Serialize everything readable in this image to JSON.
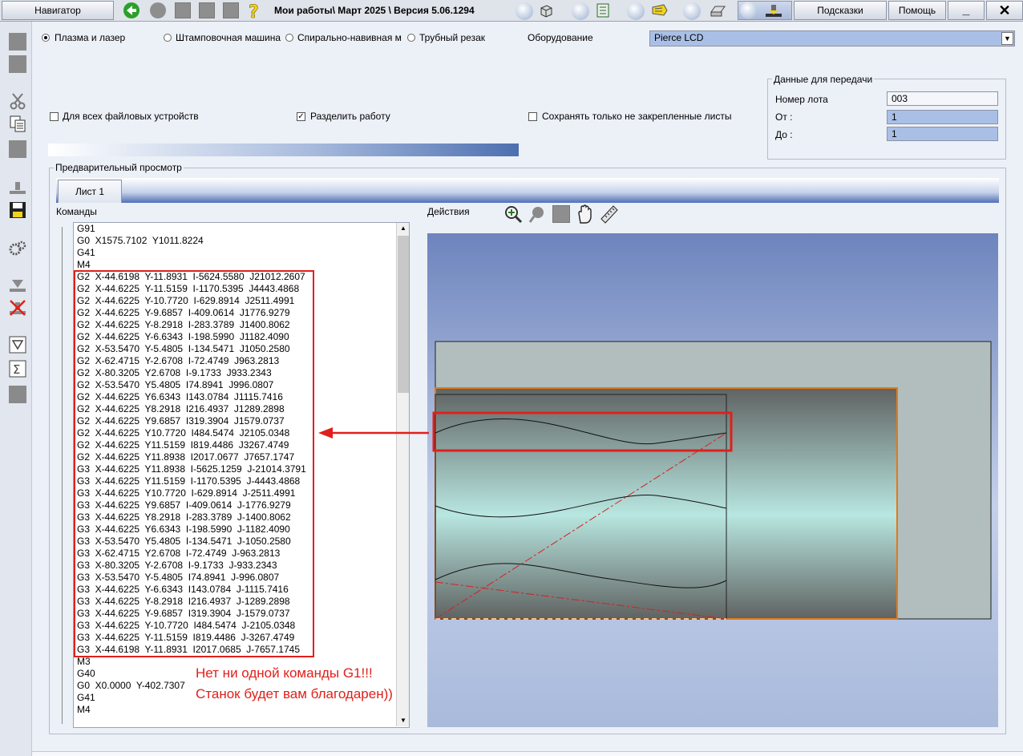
{
  "topbar": {
    "navigator_label": "Навигатор",
    "breadcrumb": "Мои работы\\  Март 2025  \\  Версия 5.06.1294",
    "hints_label": "Подсказки",
    "help_label": "Помощь",
    "minimize_label": "_",
    "close_label": "✕"
  },
  "machines": {
    "plasma_label": "Плазма и лазер",
    "stamping_label": "Штамповочная машина",
    "spiral_label": "Спирально-навивная м",
    "pipe_label": "Трубный резак",
    "selected": "Плазма и лазер"
  },
  "equipment": {
    "label": "Оборудование",
    "value": "Pierce LCD"
  },
  "options": {
    "all_devices_label": "Для всех файловых устройств",
    "split_work_label": "Разделить работу",
    "save_unlocked_label": "Сохранять только не закрепленные листы"
  },
  "transfer": {
    "title": "Данные для передачи",
    "lot_label": "Номер лота",
    "lot_value": "003",
    "from_label": "От :",
    "from_value": "1",
    "to_label": "До :",
    "to_value": "1"
  },
  "preview": {
    "title": "Предварительный просмотр",
    "sheet_tab": "Лист 1",
    "commands_label": "Команды",
    "actions_label": "Действия"
  },
  "commands": [
    "G91",
    "G0  X1575.7102  Y1011.8224",
    "G41",
    "M4",
    "G2  X-44.6198  Y-11.8931  I-5624.5580  J21012.2607",
    "G2  X-44.6225  Y-11.5159  I-1170.5395  J4443.4868",
    "G2  X-44.6225  Y-10.7720  I-629.8914  J2511.4991",
    "G2  X-44.6225  Y-9.6857  I-409.0614  J1776.9279",
    "G2  X-44.6225  Y-8.2918  I-283.3789  J1400.8062",
    "G2  X-44.6225  Y-6.6343  I-198.5990  J1182.4090",
    "G2  X-53.5470  Y-5.4805  I-134.5471  J1050.2580",
    "G2  X-62.4715  Y-2.6708  I-72.4749  J963.2813",
    "G2  X-80.3205  Y2.6708  I-9.1733  J933.2343",
    "G2  X-53.5470  Y5.4805  I74.8941  J996.0807",
    "G2  X-44.6225  Y6.6343  I143.0784  J1115.7416",
    "G2  X-44.6225  Y8.2918  I216.4937  J1289.2898",
    "G2  X-44.6225  Y9.6857  I319.3904  J1579.0737",
    "G2  X-44.6225  Y10.7720  I484.5474  J2105.0348",
    "G2  X-44.6225  Y11.5159  I819.4486  J3267.4749",
    "G2  X-44.6225  Y11.8938  I2017.0677  J7657.1747",
    "G3  X-44.6225  Y11.8938  I-5625.1259  J-21014.3791",
    "G3  X-44.6225  Y11.5159  I-1170.5395  J-4443.4868",
    "G3  X-44.6225  Y10.7720  I-629.8914  J-2511.4991",
    "G3  X-44.6225  Y9.6857  I-409.0614  J-1776.9279",
    "G3  X-44.6225  Y8.2918  I-283.3789  J-1400.8062",
    "G3  X-44.6225  Y6.6343  I-198.5990  J-1182.4090",
    "G3  X-53.5470  Y5.4805  I-134.5471  J-1050.2580",
    "G3  X-62.4715  Y2.6708  I-72.4749  J-963.2813",
    "G3  X-80.3205  Y-2.6708  I-9.1733  J-933.2343",
    "G3  X-53.5470  Y-5.4805  I74.8941  J-996.0807",
    "G3  X-44.6225  Y-6.6343  I143.0784  J-1115.7416",
    "G3  X-44.6225  Y-8.2918  I216.4937  J-1289.2898",
    "G3  X-44.6225  Y-9.6857  I319.3904  J-1579.0737",
    "G3  X-44.6225  Y-10.7720  I484.5474  J-2105.0348",
    "G3  X-44.6225  Y-11.5159  I819.4486  J-3267.4749",
    "G3  X-44.6198  Y-11.8931  I2017.0685  J-7657.1745",
    "M3",
    "G40",
    "G0  X0.0000  Y-402.7307",
    "G41",
    "M4"
  ],
  "annotation": {
    "line1": "Нет ни одной команды G1!!!",
    "line2": "Станок будет вам благодарен))",
    "color": "#e0201b"
  },
  "icons": {
    "back": "green-back-arrow-icon",
    "help": "yellow-question-icon",
    "zoom_in": "zoom-in-icon",
    "zoom_out": "zoom-out-icon",
    "hand": "pan-hand-icon",
    "ruler": "ruler-icon"
  }
}
